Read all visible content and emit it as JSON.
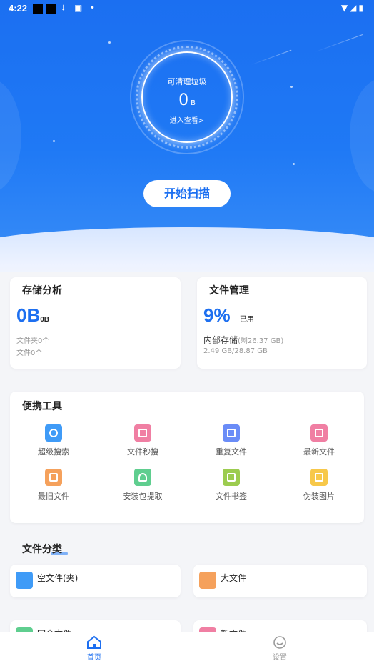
{
  "status_bar": {
    "time": "4:22"
  },
  "hero": {
    "ring_label": "可清理垃圾",
    "junk_value": "0",
    "junk_unit": "B",
    "view_link": "进入查看>",
    "scan_button": "开始扫描"
  },
  "storage_card": {
    "title": "存储分析",
    "size_value": "0B",
    "size_unit": "0B",
    "folders": "文件夹0个",
    "files": "文件0个"
  },
  "file_mgmt_card": {
    "title": "文件管理",
    "percent": "9%",
    "used_label": "已用",
    "internal_label": "内部存储",
    "remaining": "(剩26.37 GB)",
    "usage": "2.49 GB/28.87 GB"
  },
  "tools": {
    "title": "便携工具",
    "items": [
      {
        "label": "超级搜索",
        "icon": "search-icon",
        "color": "#3f9bf7"
      },
      {
        "label": "文件秒搜",
        "icon": "document-icon",
        "color": "#f07fa3"
      },
      {
        "label": "重复文件",
        "icon": "duplicate-icon",
        "color": "#6a8cf7"
      },
      {
        "label": "最新文件",
        "icon": "new-file-icon",
        "color": "#f07fa3"
      },
      {
        "label": "最旧文件",
        "icon": "archive-icon",
        "color": "#f5a15c"
      },
      {
        "label": "安装包提取",
        "icon": "android-icon",
        "color": "#5fce8f"
      },
      {
        "label": "文件书签",
        "icon": "bookmark-icon",
        "color": "#9ccc4f"
      },
      {
        "label": "伪装图片",
        "icon": "image-icon",
        "color": "#f7c84a"
      }
    ]
  },
  "categories": {
    "title": "文件分类",
    "items": [
      {
        "label": "空文件(夹)",
        "icon": "empty-folder-icon",
        "color": "#3f9bf7"
      },
      {
        "label": "大文件",
        "icon": "large-file-icon",
        "color": "#f5a15c"
      },
      {
        "label": "冗余文件",
        "icon": "redundant-file-icon",
        "color": "#5fce8f"
      },
      {
        "label": "新文件",
        "icon": "new-file-icon",
        "color": "#f07fa3"
      }
    ]
  },
  "bottom_nav": {
    "home": "首页",
    "settings": "设置"
  }
}
